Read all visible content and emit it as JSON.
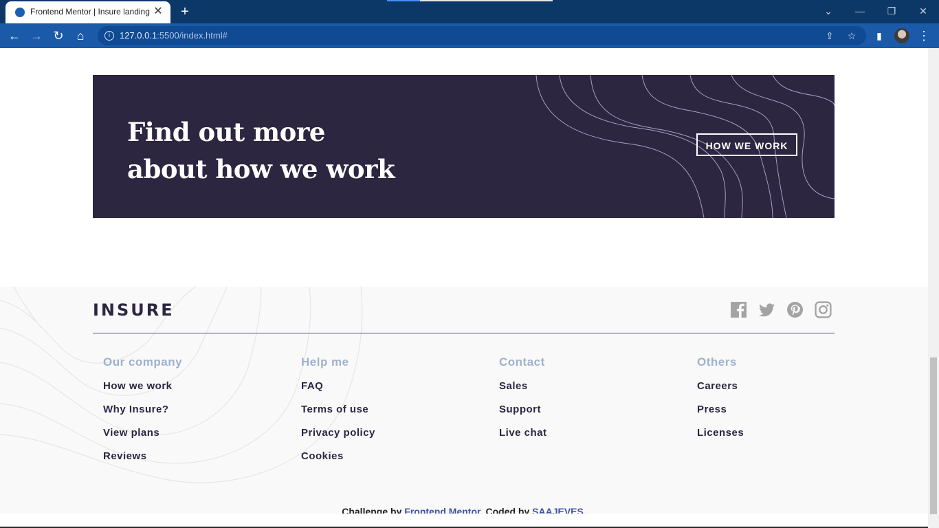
{
  "browser": {
    "tab_title": "Frontend Mentor | Insure landing page",
    "url_host": "127.0.0.1",
    "url_rest": ":5500/index.html#",
    "new_tab": "+",
    "close": "✕"
  },
  "cta": {
    "title_line1": "Find out more",
    "title_line2": "about how we work",
    "button": "HOW WE WORK"
  },
  "footer": {
    "logo": "INSURE",
    "socials": [
      "facebook-icon",
      "twitter-icon",
      "pinterest-icon",
      "instagram-icon"
    ],
    "columns": [
      {
        "title": "Our company",
        "links": [
          "How we work",
          "Why Insure?",
          "View plans",
          "Reviews"
        ]
      },
      {
        "title": "Help me",
        "links": [
          "FAQ",
          "Terms of use",
          "Privacy policy",
          "Cookies"
        ]
      },
      {
        "title": "Contact",
        "links": [
          "Sales",
          "Support",
          "Live chat"
        ]
      },
      {
        "title": "Others",
        "links": [
          "Careers",
          "Press",
          "Licenses"
        ]
      }
    ],
    "attribution": {
      "prefix": "Challenge by ",
      "link1": "Frontend Mentor",
      "middle": ". Coded by ",
      "link2": "SAAJEVES",
      "suffix": "."
    }
  },
  "colors": {
    "cta_bg": "#2c2640",
    "accent_link": "#3e52a3",
    "column_title": "#a0b1cc"
  }
}
